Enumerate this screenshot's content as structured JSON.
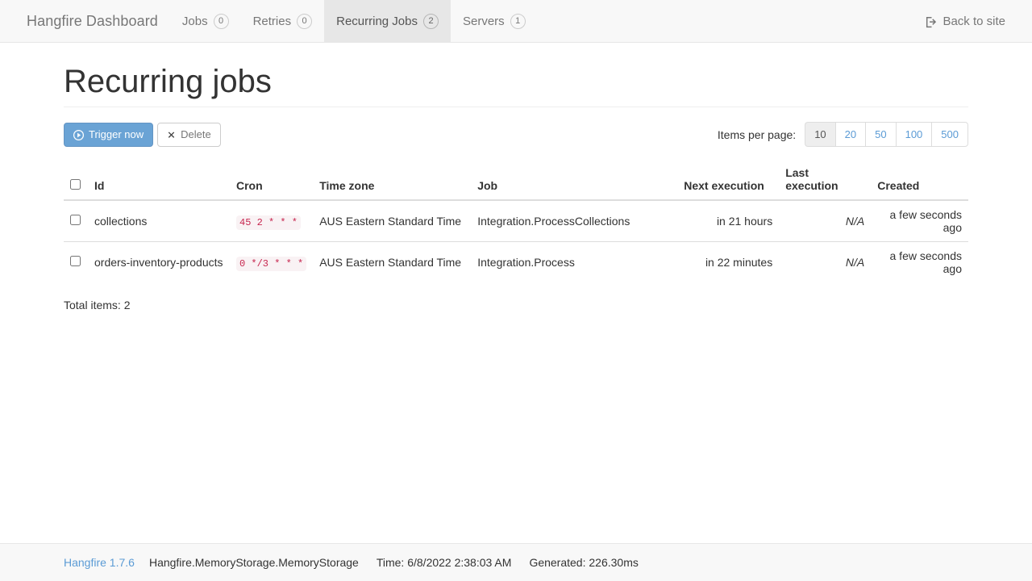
{
  "navbar": {
    "brand": "Hangfire Dashboard",
    "items": [
      {
        "label": "Jobs",
        "badge": "0",
        "active": false,
        "name": "nav-item-jobs"
      },
      {
        "label": "Retries",
        "badge": "0",
        "active": false,
        "name": "nav-item-retries"
      },
      {
        "label": "Recurring Jobs",
        "badge": "2",
        "active": true,
        "name": "nav-item-recurring-jobs"
      },
      {
        "label": "Servers",
        "badge": "1",
        "active": false,
        "name": "nav-item-servers"
      }
    ],
    "back_to_site": "Back to site",
    "back_icon": "sign-out-icon"
  },
  "page": {
    "title": "Recurring jobs"
  },
  "toolbar": {
    "trigger_label": "Trigger now",
    "trigger_icon": "play-circle-icon",
    "delete_label": "Delete",
    "delete_icon": "times-icon",
    "per_page_label": "Items per page:",
    "per_page_options": [
      "10",
      "20",
      "50",
      "100",
      "500"
    ],
    "per_page_selected": "10"
  },
  "table": {
    "columns": [
      "Id",
      "Cron",
      "Time zone",
      "Job",
      "Next execution",
      "Last execution",
      "Created"
    ],
    "rows": [
      {
        "id": "collections",
        "cron": "45 2 * * *",
        "timezone": "AUS Eastern Standard Time",
        "job": "Integration.ProcessCollections",
        "next_execution": "in 21 hours",
        "last_execution": "N/A",
        "created": "a few seconds ago"
      },
      {
        "id": "orders-inventory-products",
        "cron": "0 */3 * * *",
        "timezone": "AUS Eastern Standard Time",
        "job": "Integration.Process",
        "next_execution": "in 22 minutes",
        "last_execution": "N/A",
        "created": "a few seconds ago"
      }
    ],
    "total_items": "Total items: 2"
  },
  "footer": {
    "version_link": "Hangfire 1.7.6",
    "storage": "Hangfire.MemoryStorage.MemoryStorage",
    "time": "Time: 6/8/2022 2:38:03 AM",
    "generated": "Generated: 226.30ms"
  },
  "colors": {
    "primary": "#6aa3d5",
    "link": "#5b9bd5",
    "navbar_bg": "#f8f8f8",
    "active_tab_bg": "#e7e7e7",
    "code_fg": "#c7254e",
    "code_bg": "#f9f2f4"
  }
}
